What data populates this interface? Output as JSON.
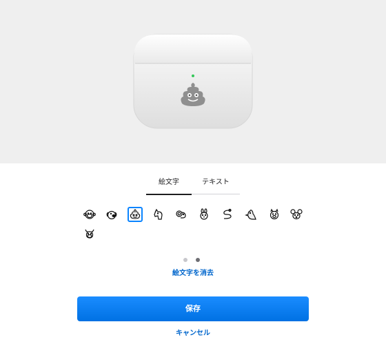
{
  "preview": {
    "product": "AirPods case",
    "engraving_icon": "pile-of-poo-icon",
    "status_light_color": "#34c759"
  },
  "tabs": [
    {
      "label": "絵文字",
      "active": true
    },
    {
      "label": "テキスト",
      "active": false
    }
  ],
  "emojis": [
    {
      "icon": "monkey-face-icon",
      "selected": false
    },
    {
      "icon": "dog-face-icon",
      "selected": false
    },
    {
      "icon": "pile-of-poo-icon",
      "selected": true
    },
    {
      "icon": "horse-face-icon",
      "selected": false
    },
    {
      "icon": "ram-icon",
      "selected": false
    },
    {
      "icon": "rabbit-face-icon",
      "selected": false
    },
    {
      "icon": "snake-icon",
      "selected": false
    },
    {
      "icon": "rooster-icon",
      "selected": false
    },
    {
      "icon": "pig-face-icon",
      "selected": false
    },
    {
      "icon": "mouse-face-icon",
      "selected": false
    },
    {
      "icon": "cow-face-icon",
      "selected": false
    }
  ],
  "pagination": {
    "current": 2,
    "total": 2
  },
  "clear_label": "絵文字を消去",
  "save_label": "保存",
  "cancel_label": "キャンセル",
  "colors": {
    "accent": "#0071e3",
    "link": "#0066cc"
  }
}
